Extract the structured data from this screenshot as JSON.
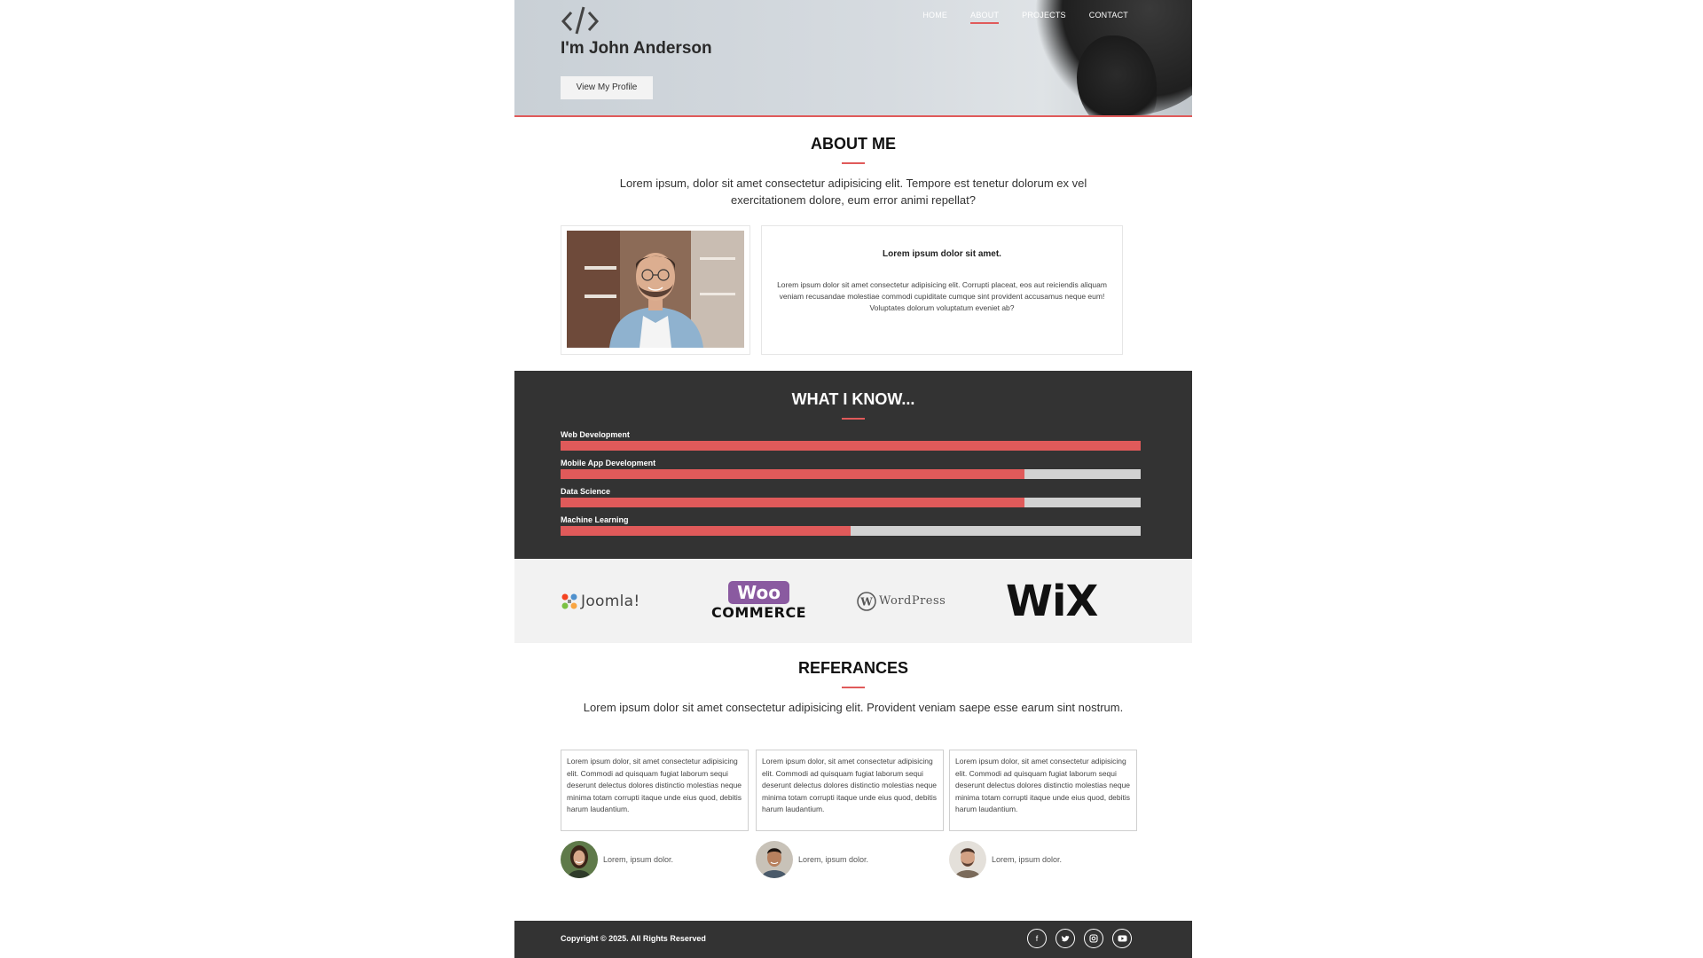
{
  "colors": {
    "accent": "#e05a5a",
    "dark": "#333333",
    "light": "#f2f2f2"
  },
  "hero": {
    "name": "I'm John Anderson",
    "button_label": "View My Profile",
    "logo_icon": "code-brackets-icon"
  },
  "nav": {
    "items": [
      {
        "label": "HOME"
      },
      {
        "label": "ABOUT"
      },
      {
        "label": "PROJECTS"
      },
      {
        "label": "CONTACT"
      }
    ],
    "active": "ABOUT"
  },
  "about": {
    "title": "ABOUT ME",
    "lead": "Lorem ipsum, dolor sit amet consectetur adipisicing elit. Tempore est tenetur dolorum ex vel exercitationem dolore, eum error animi repellat?",
    "card_title": "Lorem ipsum dolor sit amet.",
    "card_body": "Lorem ipsum dolor sit amet consectetur adipisicing elit. Corrupti placeat, eos aut reiciendis aliquam veniam recusandae molestiae commodi cupiditate cumque sint provident accusamus neque eum! Voluptates dolorum voluptatum eveniet ab?"
  },
  "skills": {
    "title": "WHAT I KNOW...",
    "items": [
      {
        "label": "Web Development",
        "level": 1.0
      },
      {
        "label": "Mobile App Development",
        "level": 0.8
      },
      {
        "label": "Data Science",
        "level": 0.8
      },
      {
        "label": "Machine Learning",
        "level": 0.5
      }
    ]
  },
  "brands": {
    "joomla": "Joomla!",
    "woo_top": "Woo",
    "woo_bottom": "COMMERCE",
    "wordpress": "WordPress",
    "wix": "WiX"
  },
  "references": {
    "title": "REFERANCES",
    "lead": "Lorem ipsum dolor sit amet consectetur adipisicing elit. Provident veniam saepe esse earum sint nostrum.",
    "cards": [
      {
        "text": "Lorem ipsum dolor, sit amet consectetur adipisicing elit. Commodi ad quisquam fugiat laborum sequi deserunt delectus dolores distinctio molestias neque minima totam corrupti itaque unde eius quod, debitis harum laudantium.",
        "name": "Lorem, ipsum dolor."
      },
      {
        "text": "Lorem ipsum dolor, sit amet consectetur adipisicing elit. Commodi ad quisquam fugiat laborum sequi deserunt delectus dolores distinctio molestias neque minima totam corrupti itaque unde eius quod, debitis harum laudantium.",
        "name": "Lorem, ipsum dolor."
      },
      {
        "text": "Lorem ipsum dolor, sit amet consectetur adipisicing elit. Commodi ad quisquam fugiat laborum sequi deserunt delectus dolores distinctio molestias neque minima totam corrupti itaque unde eius quod, debitis harum laudantium.",
        "name": "Lorem, ipsum dolor."
      }
    ]
  },
  "footer": {
    "copyright": "Copyright © 2025. All Rights Reserved",
    "social": [
      {
        "icon": "facebook-icon"
      },
      {
        "icon": "twitter-icon"
      },
      {
        "icon": "instagram-icon"
      },
      {
        "icon": "youtube-icon"
      }
    ]
  }
}
